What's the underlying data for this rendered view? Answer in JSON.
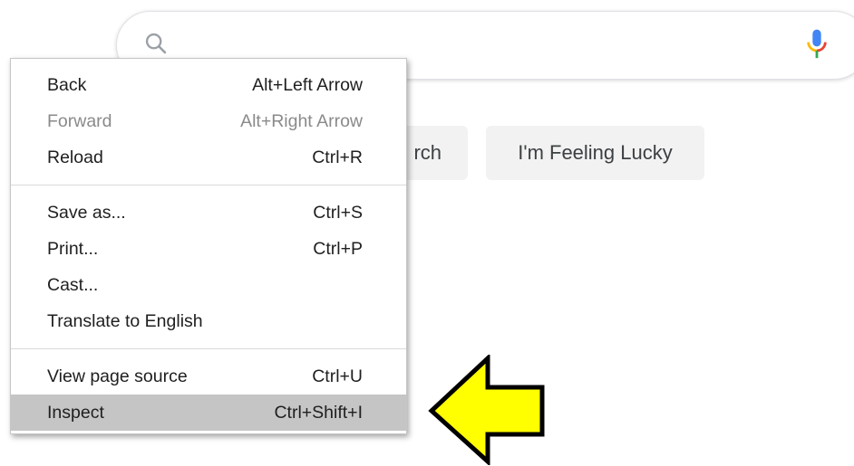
{
  "search": {
    "placeholder": "",
    "icon": "search-icon",
    "voice_icon": "microphone-icon"
  },
  "buttons": {
    "search_label": "rch",
    "lucky_label": "I'm Feeling Lucky"
  },
  "context_menu": {
    "groups": [
      [
        {
          "label": "Back",
          "shortcut": "Alt+Left Arrow"
        },
        {
          "label": "Forward",
          "shortcut": "Alt+Right Arrow",
          "disabled": true
        },
        {
          "label": "Reload",
          "shortcut": "Ctrl+R"
        }
      ],
      [
        {
          "label": "Save as...",
          "shortcut": "Ctrl+S"
        },
        {
          "label": "Print...",
          "shortcut": "Ctrl+P"
        },
        {
          "label": "Cast...",
          "shortcut": ""
        },
        {
          "label": "Translate to English",
          "shortcut": ""
        }
      ],
      [
        {
          "label": "View page source",
          "shortcut": "Ctrl+U"
        },
        {
          "label": "Inspect",
          "shortcut": "Ctrl+Shift+I",
          "highlighted": true
        }
      ]
    ]
  },
  "annotation": {
    "arrow_color": "#ffff00",
    "arrow_direction": "left"
  },
  "colors": {
    "mic_blue": "#4285f4",
    "mic_red": "#ea4335",
    "mic_yellow": "#fbbc05",
    "mic_green": "#34a853",
    "highlight": "#c5c5c5"
  }
}
